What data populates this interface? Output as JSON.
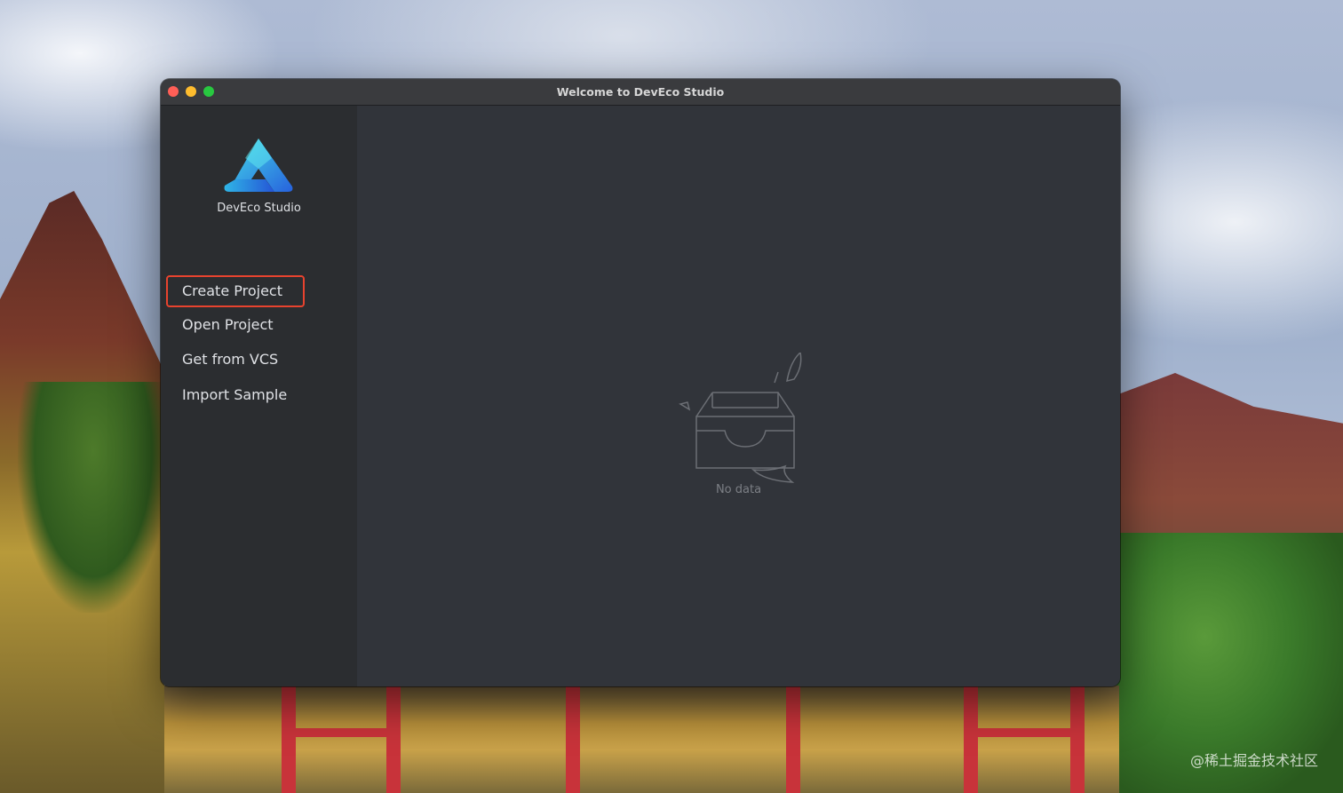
{
  "window": {
    "title": "Welcome to DevEco Studio"
  },
  "sidebar": {
    "brand": "DevEco Studio",
    "items": [
      {
        "label": "Create Project",
        "selected": true
      },
      {
        "label": "Open Project",
        "selected": false
      },
      {
        "label": "Get from VCS",
        "selected": false
      },
      {
        "label": "Import Sample",
        "selected": false
      }
    ],
    "bottom_icons": [
      "mail-icon",
      "gear-icon",
      "help-icon"
    ]
  },
  "main": {
    "empty_text": "No data",
    "empty_icon": "empty-inbox-icon"
  },
  "desktop": {
    "watermark": "@稀土掘金技术社区"
  },
  "colors": {
    "selection_border": "#e8432e",
    "logo_gradient_start": "#3fd1e8",
    "logo_gradient_end": "#2a6de0"
  }
}
